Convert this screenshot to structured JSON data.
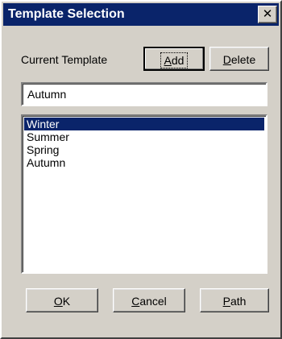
{
  "window": {
    "title": "Template Selection",
    "close_glyph": "✕"
  },
  "current_template": {
    "label": "Current Template",
    "value": "Autumn"
  },
  "buttons": {
    "add": {
      "mnemonic": "A",
      "rest": "dd"
    },
    "delete": {
      "mnemonic": "D",
      "rest": "elete"
    },
    "ok": {
      "mnemonic": "O",
      "rest": "K"
    },
    "cancel": {
      "mnemonic": "C",
      "rest": "ancel"
    },
    "path": {
      "mnemonic": "P",
      "rest": "ath"
    }
  },
  "templates": {
    "items": [
      "Winter",
      "Summer",
      "Spring",
      "Autumn"
    ],
    "selected": "Winter"
  },
  "colors": {
    "titlebar": "#0a246a",
    "face": "#d4d0c8",
    "selection": "#0a246a"
  }
}
